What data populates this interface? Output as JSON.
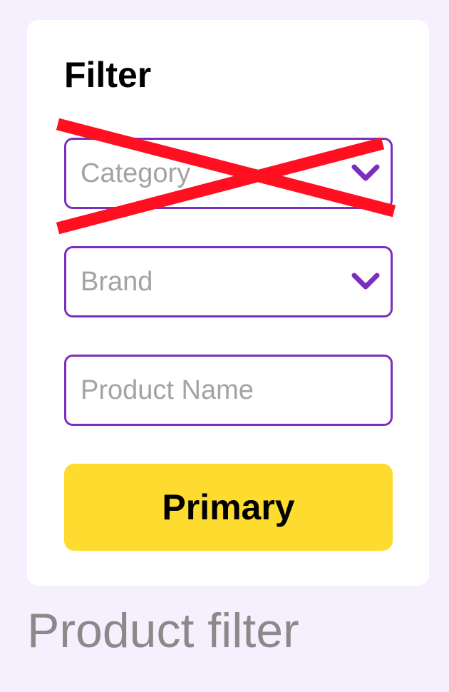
{
  "filter_panel": {
    "title": "Filter",
    "category": {
      "placeholder": "Category",
      "crossed_out": true
    },
    "brand": {
      "placeholder": "Brand"
    },
    "product_name": {
      "placeholder": "Product Name"
    },
    "primary_label": "Primary"
  },
  "caption": "Product filter",
  "icons": {
    "dropdown": "chevron-down-icon",
    "cross_out": "red-x-mark"
  },
  "colors": {
    "background": "#F6F0FE",
    "card": "#FFFFFF",
    "field_border": "#7B2FBF",
    "placeholder": "#A3A3A3",
    "button": "#FDDC2F",
    "cross_out": "#FF0F1F",
    "caption": "#8A8A8A"
  }
}
